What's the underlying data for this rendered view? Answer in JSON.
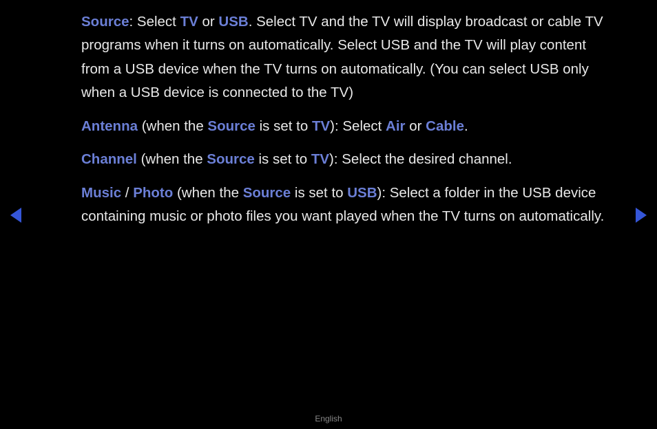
{
  "p1": {
    "kw_source": "Source",
    "t1": ": Select ",
    "kw_tv": "TV",
    "t2": " or ",
    "kw_usb": "USB",
    "t3": ". Select TV and the TV will display broadcast or cable TV programs when it turns on automatically. Select USB and the TV will play content from a USB device when the TV turns on automatically. (You can select USB only when a USB device is connected to the TV)"
  },
  "p2": {
    "kw_antenna": "Antenna",
    "t1": " (when the ",
    "kw_source": "Source",
    "t2": " is set to ",
    "kw_tv": "TV",
    "t3": "): Select ",
    "kw_air": "Air",
    "t4": " or ",
    "kw_cable": "Cable",
    "t5": "."
  },
  "p3": {
    "kw_channel": "Channel",
    "t1": " (when the ",
    "kw_source": "Source",
    "t2": " is set to ",
    "kw_tv": "TV",
    "t3": "): Select the desired channel."
  },
  "p4": {
    "kw_music": "Music",
    "t1": " / ",
    "kw_photo": "Photo",
    "t2": " (when the ",
    "kw_source": "Source",
    "t3": " is set to ",
    "kw_usb": "USB",
    "t4": "): Select a folder in the USB device containing music or photo files you want played when the TV turns on automatically."
  },
  "footer": "English"
}
